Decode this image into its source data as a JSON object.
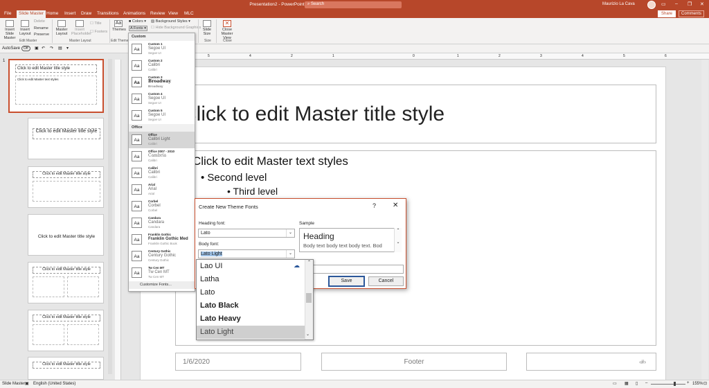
{
  "window": {
    "title": "Presentation2 - PowerPoint",
    "search_placeholder": "Search",
    "user": "Maurizio La Cava"
  },
  "tabs": [
    "File",
    "Slide Master",
    "Home",
    "Insert",
    "Draw",
    "Transitions",
    "Animations",
    "Review",
    "View",
    "MLC"
  ],
  "share": "Share",
  "comments": "Comments",
  "ribbon": {
    "insert_slide_master": "Insert Slide Master",
    "insert_layout": "Insert Layout",
    "delete": "Delete",
    "rename": "Rename",
    "preserve": "Preserve",
    "master_layout": "Master Layout",
    "insert_placeholder": "Insert Placeholder",
    "title": "Title",
    "footers": "Footers",
    "themes": "Themes",
    "colors": "Colors",
    "fonts": "Fonts",
    "background_styles": "Background Styles",
    "hide_background": "Hide Background Graphics",
    "slide_size": "Slide Size",
    "close_master_view": "Close Master View",
    "groups": {
      "edit_master": "Edit Master",
      "master_layout": "Master Layout",
      "edit_theme": "Edit Theme",
      "size": "Size",
      "close": "Close"
    }
  },
  "qat": {
    "autosave": "AutoSave",
    "autosave_state": "Off"
  },
  "ruler_numbers": [
    "5",
    "4",
    "3",
    "2",
    "1",
    "0",
    "1",
    "2",
    "3",
    "4",
    "5",
    "6"
  ],
  "thumbnails": {
    "selected_number": "1",
    "title_text": "Click to edit Master title style",
    "body_text": "Click to edit Master text styles"
  },
  "slide": {
    "title": "Click to edit Master title style",
    "level1": "Click to edit Master text styles",
    "level2": "Second level",
    "level3": "Third level",
    "date": "1/6/2020",
    "footer": "Footer",
    "number": "‹#›"
  },
  "fonts_menu": {
    "custom_header": "Custom",
    "office_header": "Office",
    "customize": "Customize Fonts...",
    "custom": [
      {
        "name": "Custom 1",
        "heading": "Segoe UI",
        "body": "Segoe UI"
      },
      {
        "name": "Custom 2",
        "heading": "Calibri",
        "body": "Calibri"
      },
      {
        "name": "Custom 3",
        "heading": "Broadway",
        "body": "Broadway"
      },
      {
        "name": "Custom 4",
        "heading": "Segoe UI",
        "body": "Segoe UI"
      },
      {
        "name": "Custom 5",
        "heading": "Segoe UI",
        "body": "Segoe UI"
      }
    ],
    "office": [
      {
        "name": "Office",
        "heading": "Calibri Light",
        "body": "Calibri"
      },
      {
        "name": "Office 2007 - 2010",
        "heading": "Cambria",
        "body": "Calibri"
      },
      {
        "name": "Calibri",
        "heading": "Calibri",
        "body": "Calibri"
      },
      {
        "name": "Arial",
        "heading": "Arial",
        "body": "Arial"
      },
      {
        "name": "Corbel",
        "heading": "Corbel",
        "body": "Corbel"
      },
      {
        "name": "Candara",
        "heading": "Candara",
        "body": "Candara"
      },
      {
        "name": "Franklin Gothic",
        "heading": "Franklin Gothic Med",
        "body": "Franklin Gothic Book"
      },
      {
        "name": "Century Gothic",
        "heading": "Century Gothic",
        "body": "Century Gothic"
      },
      {
        "name": "Tw Cen MT",
        "heading": "Tw Cen MT",
        "body": "Tw Cen MT"
      }
    ],
    "icon_text": "Aa"
  },
  "dialog": {
    "title": "Create New Theme Fonts",
    "help": "?",
    "close": "✕",
    "heading_label": "Heading font:",
    "heading_value": "Lato",
    "body_label": "Body font:",
    "body_value": "Lato Light",
    "sample_label": "Sample",
    "sample_heading": "Heading",
    "sample_body": "Body text body text body text. Bod",
    "save": "Save",
    "cancel": "Cancel"
  },
  "font_list": [
    "Lao UI",
    "Latha",
    "Lato",
    "Lato Black",
    "Lato Heavy",
    "Lato Light"
  ],
  "status": {
    "view": "Slide Master",
    "language": "English (United States)",
    "zoom": "155%"
  },
  "colors": {
    "accent": "#b7472a",
    "selection": "#c84e2d"
  }
}
